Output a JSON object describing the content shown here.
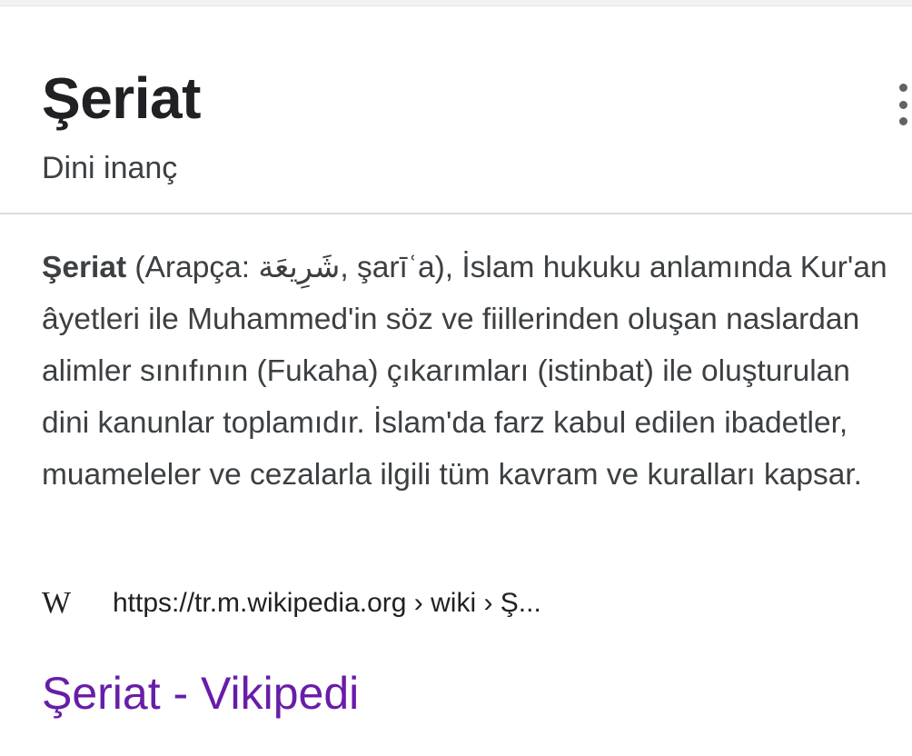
{
  "panel": {
    "title": "Şeriat",
    "subtitle": "Dini inanç",
    "menu_icon": "more-vert-icon"
  },
  "description": {
    "term": "Şeriat",
    "text": " (Arapça: شَرِيعَة, şarīʿa), İslam hukuku anlamında Kur'an âyetleri ile Muhammed'in söz ve fiillerinden oluşan naslardan alimler sınıfının (Fukaha) çıkarımları (istinbat) ile oluşturulan dini kanunlar toplamıdır. İslam'da farz kabul edilen ibadetler, muameleler ve cezalarla ilgili tüm kavram ve kuralları kapsar."
  },
  "source": {
    "logo_text": "W",
    "url": "https://tr.m.wikipedia.org › wiki › Ş..."
  },
  "result": {
    "title": "Şeriat - Vikipedi",
    "link_color": "#681da8"
  }
}
